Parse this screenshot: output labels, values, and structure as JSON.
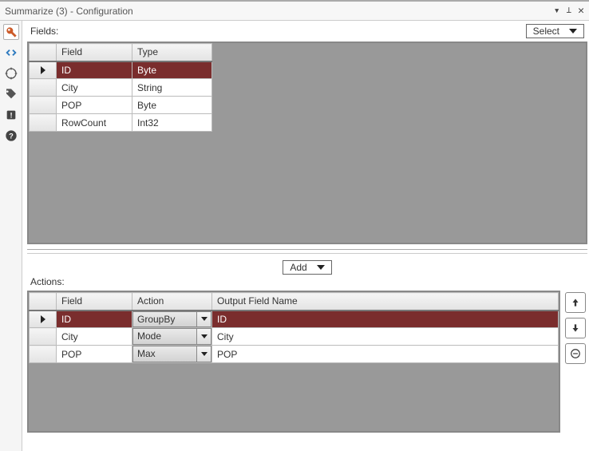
{
  "window": {
    "title": "Summarize (3) - Configuration"
  },
  "fields": {
    "label": "Fields:",
    "select_label": "Select",
    "columns": {
      "field": "Field",
      "type": "Type"
    },
    "rows": [
      {
        "field": "ID",
        "type": "Byte",
        "selected": true
      },
      {
        "field": "City",
        "type": "String",
        "selected": false
      },
      {
        "field": "POP",
        "type": "Byte",
        "selected": false
      },
      {
        "field": "RowCount",
        "type": "Int32",
        "selected": false
      }
    ]
  },
  "actions": {
    "label": "Actions:",
    "add_label": "Add",
    "columns": {
      "field": "Field",
      "action": "Action",
      "output": "Output Field Name"
    },
    "rows": [
      {
        "field": "ID",
        "action": "GroupBy",
        "output": "ID",
        "selected": true
      },
      {
        "field": "City",
        "action": "Mode",
        "output": "City",
        "selected": false
      },
      {
        "field": "POP",
        "action": "Max",
        "output": "POP",
        "selected": false
      }
    ]
  }
}
